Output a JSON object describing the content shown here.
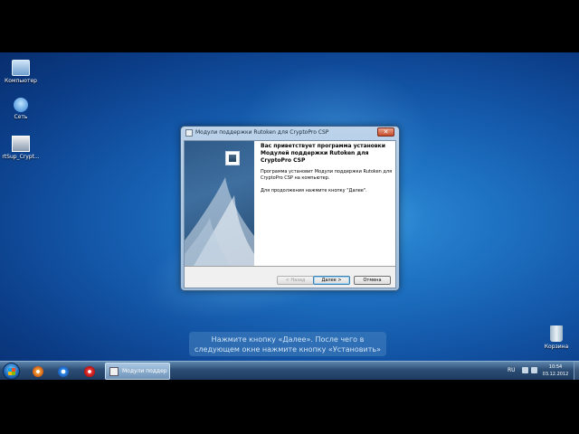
{
  "desktop": {
    "icons": [
      {
        "label": "Компьютер"
      },
      {
        "label": "Сеть"
      },
      {
        "label": "rtSup_Crypt..."
      },
      {
        "label": "Корзина"
      }
    ]
  },
  "dialog": {
    "title": "Модули поддержки Rutoken для CryptoPro CSP",
    "close_glyph": "✕",
    "heading": "Вас приветствует программа установки Модулей поддержки Rutoken для CryptoPro CSP",
    "paragraph1": "Программа установит Модули поддержки Rutoken для CryptoPro CSP на компьютер.",
    "paragraph2": "Для продолжения нажмите кнопку \"Далее\".",
    "buttons": {
      "back": "< Назад",
      "next": "Далее >",
      "cancel": "Отмена"
    }
  },
  "caption": "Нажмите кнопку «Далее». После чего в следующем окне нажмите кнопку «Установить»",
  "taskbar": {
    "task_label": "Модули поддер...",
    "language": "RU",
    "time": "10:54",
    "date": "03.12.2012"
  },
  "colors": {
    "desktop": "#1d6fc0",
    "taskbar": "#2c4d74",
    "banner": "#3f6f9f"
  }
}
